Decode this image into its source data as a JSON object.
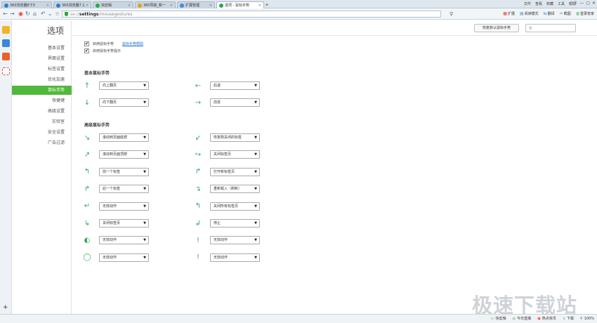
{
  "browser": {
    "tabs": [
      {
        "label": "360浏览器8下X",
        "color": "#2a7ed3",
        "active": false
      },
      {
        "label": "360浏览器7.1:",
        "color": "#2a7ed3",
        "active": false
      },
      {
        "label": "快剪辑",
        "color": "#2aa84e",
        "active": false
      },
      {
        "label": "360导航_新一",
        "color": "#e0a21f",
        "active": false
      },
      {
        "label": "扩展管理",
        "color": "#3c8fdc",
        "active": false
      },
      {
        "label": "选项 - 鼠标手势",
        "color": "#2aa84e",
        "active": true
      }
    ],
    "menu": [
      "文件",
      "查看",
      "收藏",
      "工具",
      "帮助"
    ],
    "window_buttons": [
      "⇧",
      "—",
      "▢",
      "✕"
    ],
    "url": {
      "scheme": "se://",
      "path": "settings",
      "rest": "/mousegestures"
    },
    "toolbar": [
      "扩展",
      "阅读模式",
      "翻译",
      "截图",
      "登录管家"
    ],
    "status": [
      "快剪辑",
      "今日直播",
      "热点资讯",
      "下载",
      "100%"
    ]
  },
  "sidebar_apps": [
    {
      "name": "favorites-star-icon",
      "color": "#f5b324"
    },
    {
      "name": "notes-icon",
      "color": "#3a88d8"
    },
    {
      "name": "weibo-icon",
      "color": "#e8632a"
    },
    {
      "name": "capture-icon",
      "color": "#e84c3d"
    }
  ],
  "page": {
    "title": "选项",
    "nav": [
      "基本设置",
      "界面设置",
      "标签设置",
      "优化加速",
      "鼠标手势",
      "快捷键",
      "高级设置",
      "实验室",
      "安全设置",
      "广告过滤"
    ],
    "active_nav": 4,
    "accent": "#52b83a",
    "restore_button": "恢复默认鼠标手势",
    "search_placeholder": "",
    "enable_label": "启用鼠标手势",
    "help_link": "鼠标手势帮助",
    "tip_label": "启用鼠标手势提示",
    "basic_section": "基本鼠标手势",
    "advanced_section": "高级鼠标手势"
  },
  "basic_gestures": [
    {
      "icon": "↑",
      "icon_name": "gesture-up-icon",
      "value": "向上翻页"
    },
    {
      "icon": "←",
      "icon_name": "gesture-left-icon",
      "value": "后退"
    },
    {
      "icon": "↓",
      "icon_name": "gesture-down-icon",
      "value": "向下翻页"
    },
    {
      "icon": "→",
      "icon_name": "gesture-right-icon",
      "value": "前进"
    }
  ],
  "advanced_gestures": [
    {
      "icon": "↘",
      "icon_name": "gesture-down-right-icon",
      "value": "滚动到页面底部"
    },
    {
      "icon": "↙",
      "icon_name": "gesture-left-down-icon",
      "value": "恢复刚关闭的标签"
    },
    {
      "icon": "↗",
      "icon_name": "gesture-up-right-icon",
      "value": "滚动到页面顶部"
    },
    {
      "icon": "↪",
      "icon_name": "gesture-right-down-icon",
      "value": "关闭标签页"
    },
    {
      "icon": "↰",
      "icon_name": "gesture-up-left-icon",
      "value": "前一个标签"
    },
    {
      "icon": "↱",
      "icon_name": "gesture-up-right-curve-icon",
      "value": "打开新标签页"
    },
    {
      "icon": "↱",
      "icon_name": "gesture-right-up-icon",
      "value": "后一个标签"
    },
    {
      "icon": "↴",
      "icon_name": "gesture-right-down-curve-icon",
      "value": "重新载入（刷新）"
    },
    {
      "icon": "↵",
      "icon_name": "gesture-down-left-icon",
      "value": "无效动作"
    },
    {
      "icon": "↰",
      "icon_name": "gesture-up-left-curve-icon",
      "value": "关闭所有标签页"
    },
    {
      "icon": "↳",
      "icon_name": "gesture-down-right-curve-icon",
      "value": "关闭标签页"
    },
    {
      "icon": "↲",
      "icon_name": "gesture-down-left-curve-icon",
      "value": "停止"
    },
    {
      "icon": "◐",
      "icon_name": "mouse-left-click-icon",
      "value": "无效动作"
    },
    {
      "icon": "!",
      "icon_name": "mouse-right-click-icon",
      "value": "无效动作"
    },
    {
      "icon": "◯",
      "icon_name": "mouse-wheel-icon",
      "value": "无效动作"
    },
    {
      "icon": "!",
      "icon_name": "mouse-wheel-right-icon",
      "value": "无效动作"
    }
  ],
  "watermark": "极速下载站"
}
